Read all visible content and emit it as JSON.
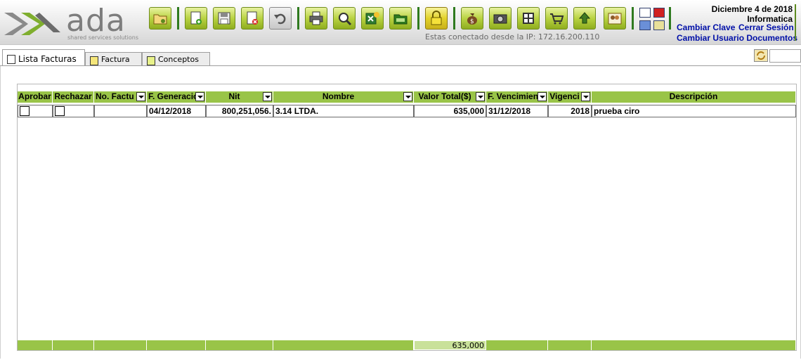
{
  "brand": {
    "logo_word": "ada",
    "logo_tagline": "shared services solutions"
  },
  "toolbar": {
    "buttons": [
      {
        "name": "open-folder-icon"
      },
      {
        "name": "new-document-icon"
      },
      {
        "name": "save-icon"
      },
      {
        "name": "delete-icon"
      },
      {
        "name": "undo-icon"
      },
      {
        "name": "print-icon"
      },
      {
        "name": "search-icon"
      },
      {
        "name": "excel-export-icon"
      },
      {
        "name": "money-folder-icon"
      },
      {
        "name": "lock-icon"
      },
      {
        "name": "money-bag-icon"
      },
      {
        "name": "camera-icon"
      },
      {
        "name": "calculator-icon"
      },
      {
        "name": "cart-icon"
      },
      {
        "name": "upload-icon"
      },
      {
        "name": "users-icon"
      }
    ],
    "ip_notice": "Estas conectado desde la IP: 172.16.200.110"
  },
  "user_panel": {
    "date": "Diciembre 4 de 2018",
    "department": "Informatica",
    "change_password": "Cambiar Clave",
    "logout": "Cerrar Sesión",
    "change_user_docs": "Cambiar Usuario Documentos"
  },
  "tabs": [
    {
      "label": "Lista Facturas",
      "active": true
    },
    {
      "label": "Factura",
      "active": false
    },
    {
      "label": "Conceptos",
      "active": false
    }
  ],
  "grid": {
    "columns": [
      {
        "label": "Aprobar"
      },
      {
        "label": "Rechazar"
      },
      {
        "label": "No. Factu"
      },
      {
        "label": "F. Generació"
      },
      {
        "label": "Nit"
      },
      {
        "label": "Nombre"
      },
      {
        "label": "Valor Total($)"
      },
      {
        "label": "F. Vencimien"
      },
      {
        "label": "Vigenci"
      },
      {
        "label": "Descripción"
      }
    ],
    "rows": [
      {
        "aprobar": false,
        "rechazar": false,
        "no_factura": "",
        "f_generacion": "04/12/2018",
        "nit": "800,251,056.",
        "nombre": "3.14 LTDA.",
        "valor_total": "635,000",
        "f_vencimiento": "31/12/2018",
        "vigencia": "2018",
        "descripcion": "prueba ciro"
      }
    ],
    "footer_total": "635,000"
  },
  "colors": {
    "header_green": "#99c448",
    "footer_green": "#99c448",
    "link_blue": "#000fa8",
    "button_green": "#b9d342"
  }
}
